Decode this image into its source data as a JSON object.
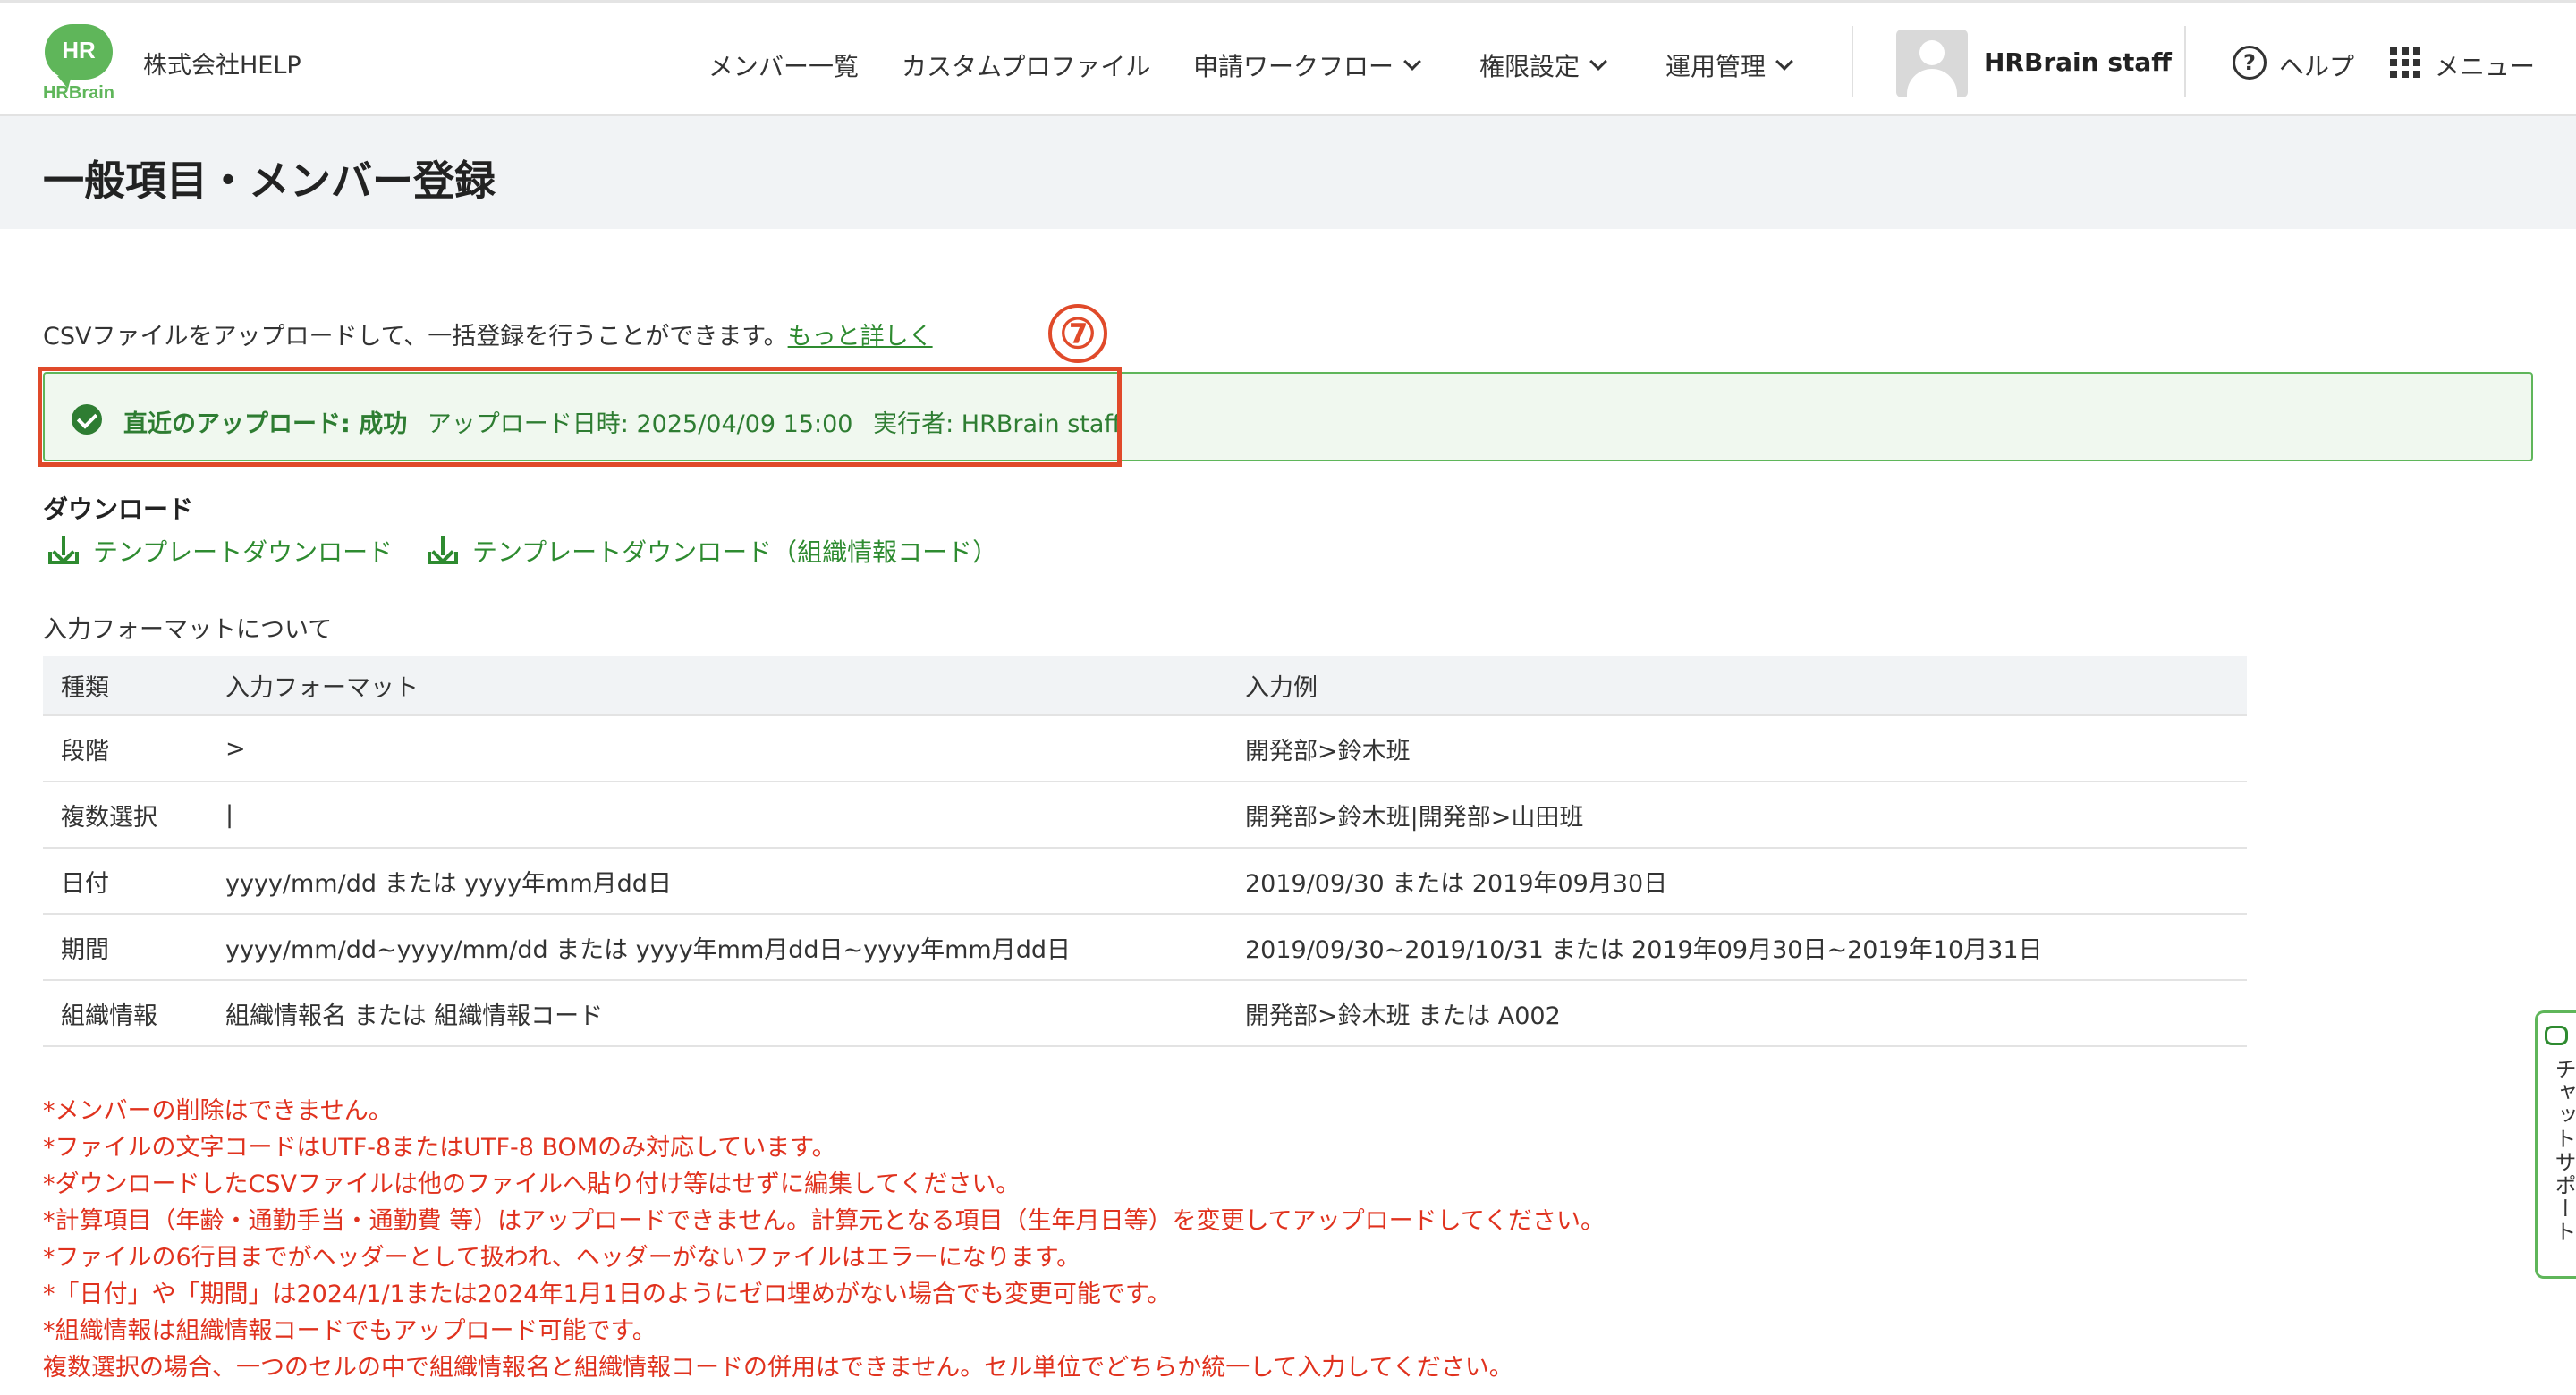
{
  "header": {
    "logo_mark": "HR",
    "logo_brand": "HRBrain",
    "company": "株式会社HELP",
    "nav": [
      {
        "label": "メンバー一覧"
      },
      {
        "label": "カスタムプロファイル"
      },
      {
        "label": "申請ワークフロー"
      },
      {
        "label": "権限設定"
      },
      {
        "label": "運用管理"
      }
    ],
    "user_name": "HRBrain staff",
    "help_symbol": "?",
    "help_label": "ヘルプ",
    "menu_label": "メニュー"
  },
  "page": {
    "title": "一般項目・メンバー登録"
  },
  "intro": {
    "text": "CSVファイルをアップロードして、一括登録を行うことができます。",
    "link": "もっと詳しく"
  },
  "annotation": {
    "step_number": "⑦"
  },
  "upload_status": {
    "status_label": "直近のアップロード: 成功",
    "datetime": "アップロード日時: 2025/04/09 15:00",
    "executor": "実行者: HRBrain staff"
  },
  "download": {
    "heading": "ダウンロード",
    "links": [
      {
        "label": "テンプレートダウンロード"
      },
      {
        "label": "テンプレートダウンロード（組織情報コード）"
      }
    ]
  },
  "format": {
    "heading": "入力フォーマットについて",
    "columns": [
      "種類",
      "入力フォーマット",
      "入力例"
    ],
    "rows": [
      [
        "段階",
        ">",
        "開発部>鈴木班"
      ],
      [
        "複数選択",
        "|",
        "開発部>鈴木班|開発部>山田班"
      ],
      [
        "日付",
        "yyyy/mm/dd または yyyy年mm月dd日",
        "2019/09/30 または 2019年09月30日"
      ],
      [
        "期間",
        "yyyy/mm/dd~yyyy/mm/dd または yyyy年mm月dd日~yyyy年mm月dd日",
        "2019/09/30~2019/10/31 または 2019年09月30日~2019年10月31日"
      ],
      [
        "組織情報",
        "組織情報名 または 組織情報コード",
        "開発部>鈴木班 または A002"
      ]
    ]
  },
  "notes": [
    "*メンバーの削除はできません。",
    "*ファイルの文字コードはUTF-8またはUTF-8 BOMのみ対応しています。",
    "*ダウンロードしたCSVファイルは他のファイルへ貼り付け等はせずに編集してください。",
    "*計算項目（年齢・通勤手当・通勤費 等）はアップロードできません。計算元となる項目（生年月日等）を変更してアップロードしてください。",
    "*ファイルの6行目までがヘッダーとして扱われ、ヘッダーがないファイルはエラーになります。",
    "*「日付」や「期間」は2024/1/1または2024年1月1日のようにゼロ埋めがない場合でも変更可能です。",
    "*組織情報は組織情報コードでもアップロード可能です。",
    "複数選択の場合、一つのセルの中で組織情報名と組織情報コードの併用はできません。セル単位でどちらか統一して入力してください。"
  ],
  "chat": {
    "label": "チャットサポート"
  },
  "colors": {
    "brand_green": "#5fb65a",
    "link_green": "#2e8b30",
    "success_text": "#2e7d32",
    "annotation_red": "#e04a2a",
    "note_red": "#e0321e"
  }
}
